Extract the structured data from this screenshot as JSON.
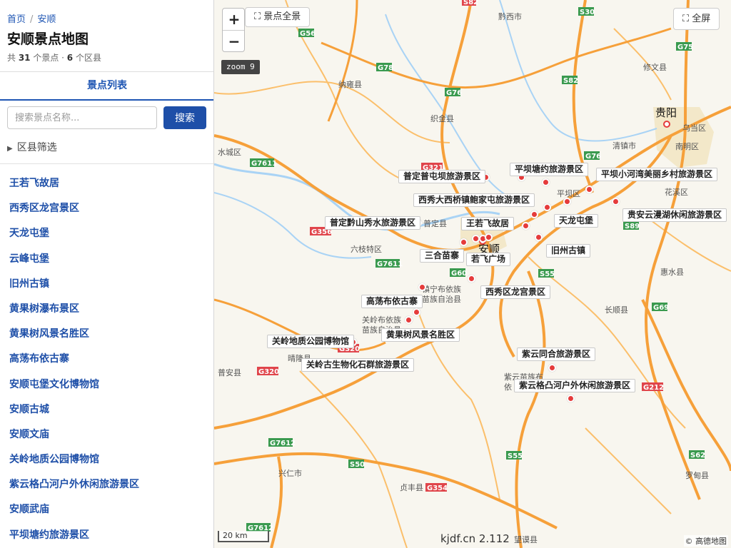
{
  "breadcrumb": {
    "home": "首页",
    "current": "安顺"
  },
  "page_title": "安顺景点地图",
  "stats": {
    "prefix": "共 ",
    "spots": "31",
    "mid": " 个景点 · ",
    "districts": "6",
    "suffix": " 个区县"
  },
  "tab_label": "景点列表",
  "search": {
    "placeholder": "搜索景点名称...",
    "button": "搜索"
  },
  "filter_label": "区县筛选",
  "spot_list": [
    "王若飞故居",
    "西秀区龙宫景区",
    "天龙屯堡",
    "云峰屯堡",
    "旧州古镇",
    "黄果树瀑布景区",
    "黄果树风景名胜区",
    "高荡布依古寨",
    "安顺屯堡文化博物馆",
    "安顺古城",
    "安顺文庙",
    "关岭地质公园博物馆",
    "紫云格凸河户外休闲旅游景区",
    "安顺武庙",
    "平坝塘约旅游景区"
  ],
  "map": {
    "zoom_in": "+",
    "zoom_out": "−",
    "overview_button": "⛶ 景点全景",
    "fullscreen_button": "⛶ 全屏",
    "zoom_level": "zoom 9",
    "scale": "20 km",
    "brand": "kjdf.cn 2.112",
    "attribution": "© 高德地图",
    "colors": {
      "land": "#f8f6ef",
      "highway": "#f6a03a",
      "road": "#fbbf6b",
      "river": "#a9d3f5",
      "marker": "#e53b3b",
      "shield_red": "#e0454b",
      "shield_green": "#3a9a4f"
    },
    "towns": {
      "guiyang": "贵阳",
      "anshun": "安顺",
      "qianxi": "黔西市",
      "xiuwen": "修文县",
      "nayong": "纳雍县",
      "zhijin": "织金县",
      "shuicheng": "水城区",
      "qingzhen": "清镇市",
      "wudang": "乌当区",
      "nanming": "南明区",
      "huaxi": "花溪区",
      "pingba": "平坝区",
      "puding": "普定县",
      "liuzhi": "六枝特区",
      "zhenning": "镇宁布依族",
      "zhenning2": "苗族自治县",
      "guanling": "关岭布依族",
      "guanling2": "苗族自治县",
      "qinglong": "晴隆县",
      "puan": "普安县",
      "changshun": "长顺县",
      "huishui": "惠水县",
      "ziyun": "紫云苗族布",
      "ziyun2": "依",
      "xingren": "兴仁市",
      "zhenfeng": "贞丰县",
      "luodian": "罗甸县",
      "wangmo": "望谟县"
    },
    "shields": {
      "s82a": "S82",
      "s30": "S30",
      "g56": "G56",
      "g75": "G75",
      "g78": "G78",
      "s82b": "S82",
      "g76a": "G76",
      "g321": "G321",
      "g76b": "G76",
      "g7611a": "G7611",
      "g356": "G356",
      "g7611b": "G7611",
      "g60": "G60",
      "s55a": "S55",
      "s89": "S89",
      "g69": "G69",
      "g320a": "G320",
      "g320b": "G320",
      "g212": "G212",
      "g7612a": "G7612",
      "s50": "S50",
      "s55b": "S55",
      "g354": "G354",
      "s62": "S62",
      "g7612b": "G7612"
    },
    "poi_labels": [
      "普定普屯坝旅游景区",
      "平坝塘约旅游景区",
      "平坝小河湾美丽乡村旅游景区",
      "西秀大西桥镇鲍家屯旅游景区",
      "普定黔山秀水旅游景区",
      "王若飞故居",
      "天龙屯堡",
      "贵安云漫湖休闲旅游景区",
      "三合苗寨",
      "若飞广场",
      "旧州古镇",
      "高荡布依古寨",
      "西秀区龙宫景区",
      "黄果树风景名胜区",
      "关岭地质公园博物馆",
      "关岭古生物化石群旅游景区",
      "紫云同合旅游景区",
      "紫云格凸河户外休闲旅游景区"
    ]
  }
}
